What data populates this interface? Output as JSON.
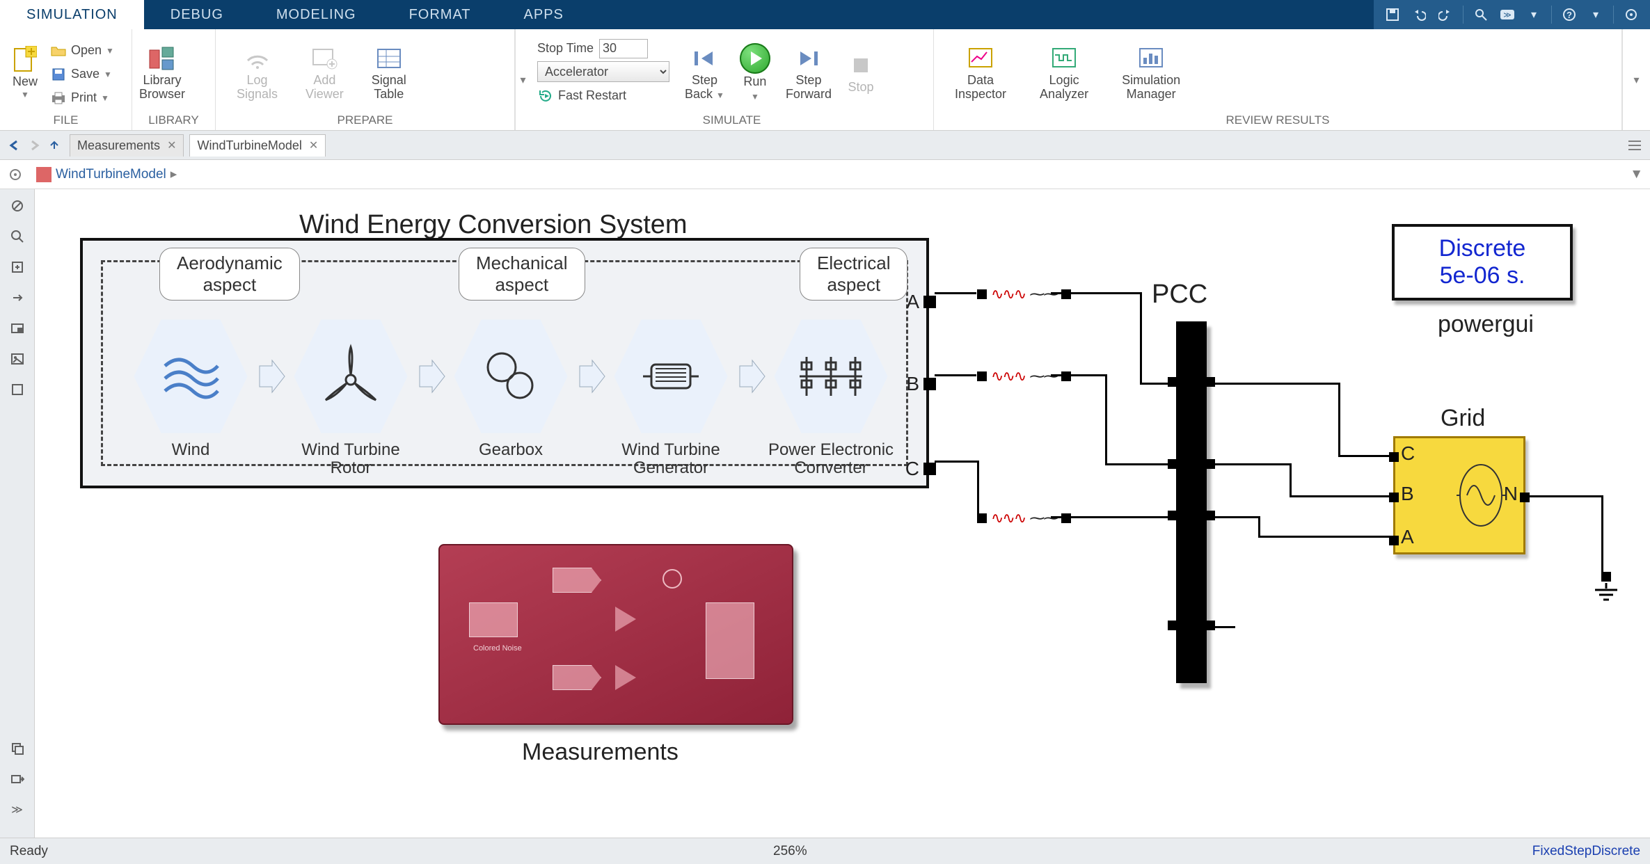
{
  "tabs": {
    "simulation": "SIMULATION",
    "debug": "DEBUG",
    "modeling": "MODELING",
    "format": "FORMAT",
    "apps": "APPS"
  },
  "ribbon": {
    "file": {
      "group": "FILE",
      "new": "New",
      "open": "Open",
      "save": "Save",
      "print": "Print"
    },
    "library": {
      "group": "LIBRARY",
      "browser_l1": "Library",
      "browser_l2": "Browser"
    },
    "prepare": {
      "group": "PREPARE",
      "log_l1": "Log",
      "log_l2": "Signals",
      "add_l1": "Add",
      "add_l2": "Viewer",
      "sig_l1": "Signal",
      "sig_l2": "Table"
    },
    "simulate": {
      "group": "SIMULATE",
      "stop_time_label": "Stop Time",
      "stop_time_value": "30",
      "mode": "Accelerator",
      "fast_restart": "Fast Restart",
      "step_back_l1": "Step",
      "step_back_l2": "Back",
      "run": "Run",
      "step_fwd_l1": "Step",
      "step_fwd_l2": "Forward",
      "stop": "Stop"
    },
    "review": {
      "group": "REVIEW RESULTS",
      "di_l1": "Data",
      "di_l2": "Inspector",
      "la_l1": "Logic",
      "la_l2": "Analyzer",
      "sm_l1": "Simulation",
      "sm_l2": "Manager"
    }
  },
  "model_tabs": {
    "t1": "Measurements",
    "t2": "WindTurbineModel"
  },
  "crumb": {
    "model": "WindTurbineModel"
  },
  "diagram": {
    "wecs_title": "Wind Energy Conversion System",
    "aspect_aero": "Aerodynamic\naspect",
    "aspect_mech": "Mechanical\naspect",
    "aspect_elec": "Electrical\naspect",
    "hex_wind": "Wind",
    "hex_rotor": "Wind Turbine\nRotor",
    "hex_gear": "Gearbox",
    "hex_gen": "Wind Turbine\nGenerator",
    "hex_conv": "Power Electronic\nConverter",
    "port_a": "A",
    "port_b": "B",
    "port_c": "C",
    "pcc": "PCC",
    "powergui_l1": "Discrete",
    "powergui_l2": "5e-06 s.",
    "powergui_cap": "powergui",
    "grid": "Grid",
    "grid_c": "C",
    "grid_b": "B",
    "grid_a": "A",
    "grid_n": "N",
    "meas_inner": "Colored Noise",
    "measurements": "Measurements"
  },
  "status": {
    "ready": "Ready",
    "zoom": "256%",
    "solver": "FixedStepDiscrete"
  }
}
